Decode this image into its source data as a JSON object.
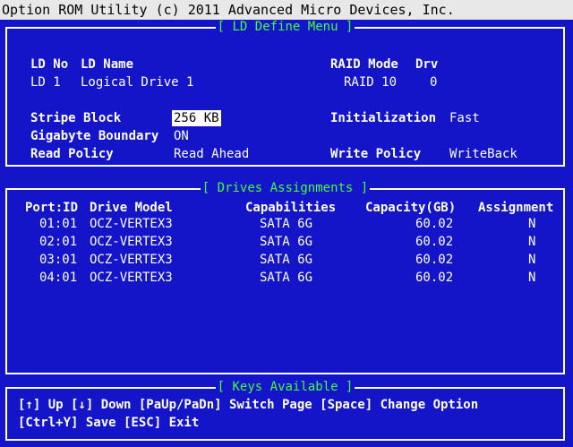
{
  "window": {
    "title": "Option ROM Utility (c) 2011 Advanced Micro Devices, Inc."
  },
  "ld_panel": {
    "title": "[ LD Define Menu ]",
    "headers": {
      "ld_no": "LD No",
      "ld_name": "LD Name",
      "raid_mode": "RAID Mode",
      "drv": "Drv"
    },
    "row": {
      "ld_no": "LD  1",
      "ld_name": "Logical Drive 1",
      "raid_mode": "RAID 10",
      "drv": "0"
    },
    "options": {
      "stripe_block_label": "Stripe Block",
      "stripe_block_value": "256 KB",
      "gigabyte_boundary_label": "Gigabyte Boundary",
      "gigabyte_boundary_value": "ON",
      "read_policy_label": "Read Policy",
      "read_policy_value": "Read Ahead",
      "initialization_label": "Initialization",
      "initialization_value": "Fast",
      "write_policy_label": "Write Policy",
      "write_policy_value": "WriteBack"
    }
  },
  "drives_panel": {
    "title": "[ Drives Assignments ]",
    "columns": {
      "port": "Port:ID",
      "model": "Drive Model",
      "caps": "Capabilities",
      "capacity": "Capacity(GB)",
      "assign": "Assignment"
    },
    "rows": [
      {
        "port": "01:01",
        "model": "OCZ-VERTEX3",
        "caps": "SATA 6G",
        "capacity": "60.02",
        "assign": "N"
      },
      {
        "port": "02:01",
        "model": "OCZ-VERTEX3",
        "caps": "SATA 6G",
        "capacity": "60.02",
        "assign": "N"
      },
      {
        "port": "03:01",
        "model": "OCZ-VERTEX3",
        "caps": "SATA 6G",
        "capacity": "60.02",
        "assign": "N"
      },
      {
        "port": "04:01",
        "model": "OCZ-VERTEX3",
        "caps": "SATA 6G",
        "capacity": "60.02",
        "assign": "N"
      }
    ]
  },
  "keys_panel": {
    "title": "[ Keys Available ]",
    "line1": "[↑] Up  [↓] Down  [PaUp/PaDn] Switch Page  [Space] Change Option",
    "line2": "[Ctrl+Y] Save  [ESC] Exit"
  },
  "colors": {
    "background": "#1414c8",
    "panel_title": "#3cff3c",
    "titlebar": "#e8e8e8"
  }
}
